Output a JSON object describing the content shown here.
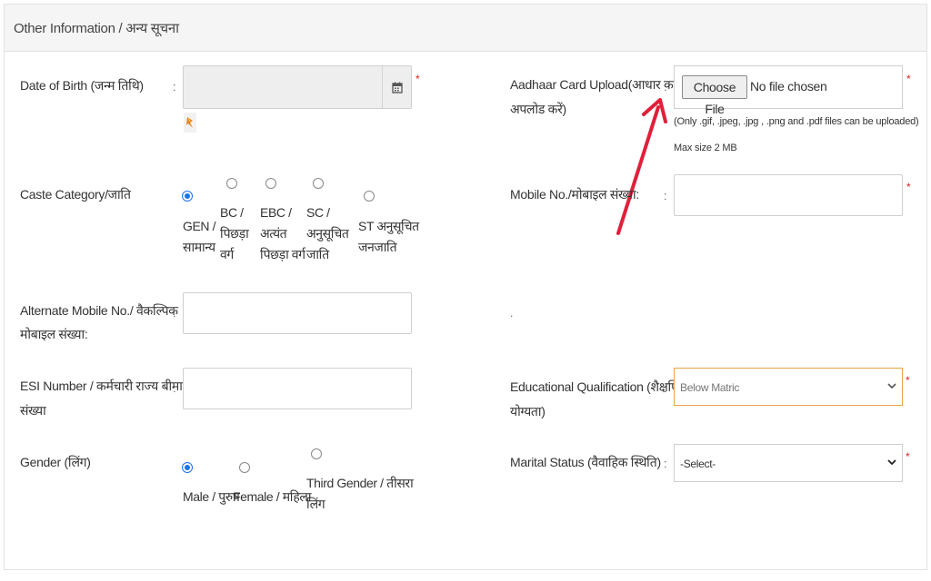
{
  "section": {
    "title": "Other Information / अन्य सूचना"
  },
  "dob": {
    "label": "Date of Birth (जन्म तिथि)",
    "colon": ":",
    "required": "*"
  },
  "caste": {
    "label": "Caste Category/जाति",
    "options": [
      {
        "lines": [
          "GEN /",
          "सामान्य"
        ],
        "selected": true
      },
      {
        "lines": [
          "BC /",
          "पिछड़ा",
          "वर्ग"
        ],
        "selected": false
      },
      {
        "lines": [
          "EBC /",
          "अत्यंत",
          "पिछड़ा वर्ग"
        ],
        "selected": false
      },
      {
        "lines": [
          "SC /",
          "अनुसूचित",
          "जाति"
        ],
        "selected": false
      },
      {
        "lines": [
          "ST अनुसूचित",
          "जनजाति"
        ],
        "selected": false
      }
    ]
  },
  "alt_mobile": {
    "label_line1": "Alternate Mobile No./ वैकल्पिक",
    "label_line2": "मोबाइल संख्या:",
    "colon": ":"
  },
  "esi": {
    "label_line1": "ESI Number / कर्मचारी राज्य बीमा",
    "label_line2": "संख्या",
    "colon": ":"
  },
  "gender": {
    "label": "Gender (लिंग)",
    "options": [
      {
        "lines": [
          "Male / पुरुष"
        ],
        "selected": true
      },
      {
        "lines": [
          "Female / महिला"
        ],
        "selected": false
      },
      {
        "lines": [
          "Third Gender / तीसरा",
          "लिंग"
        ],
        "selected": false
      }
    ]
  },
  "aadhaar": {
    "label_line1": "Aadhaar Card Upload(आधार कार्ड",
    "label_line2": "अपलोड करें)",
    "colon": ":",
    "button": "Choose File",
    "status": "No file chosen",
    "hint": "(Only .gif, .jpeg, .jpg , .png and .pdf files can be uploaded)",
    "max_size": "Max size 2 MB",
    "required": "*"
  },
  "mobile": {
    "label": "Mobile No./मोबाइल संख्या:",
    "colon": ":",
    "required": "*"
  },
  "dot": ".",
  "education": {
    "label_line1": "Educational Qualification (शैक्षणिक",
    "label_line2": "योग्यता)",
    "colon": ":",
    "value": "Below Matric",
    "required": "*"
  },
  "marital": {
    "label": "Marital Status (वैवाहिक स्थिति)",
    "colon": ":",
    "value": "-Select-",
    "required": "*"
  },
  "colors": {
    "accent": "#1a73e8",
    "required": "#e02020",
    "arrow": "#e0203a",
    "focus": "#e8a44a"
  }
}
